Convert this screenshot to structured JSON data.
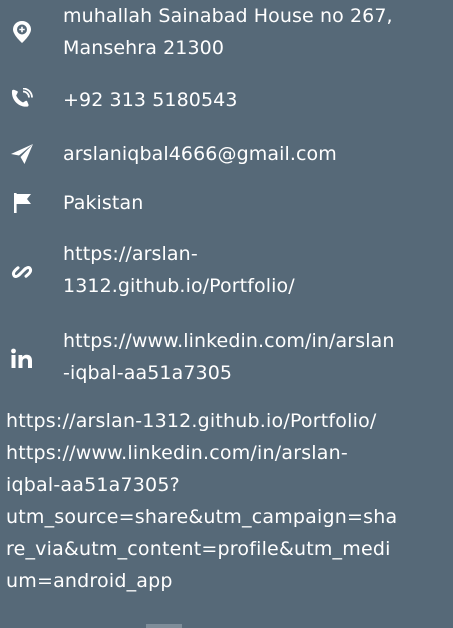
{
  "contact": {
    "address_line1": "muhallah Sainabad House no 267,",
    "address_line2": "Mansehra 21300",
    "phone": "+92 313 5180543",
    "email": "arslaniqbal4666@gmail.com",
    "country": "Pakistan",
    "portfolio_line1": "https://arslan-",
    "portfolio_line2": "1312.github.io/Portfolio/",
    "linkedin_line1": "https://www.linkedin.com/in/arslan",
    "linkedin_line2": "-iqbal-aa51a7305"
  },
  "notes": {
    "line1": "https://arslan-1312.github.io/Portfolio/",
    "line2": "https://www.linkedin.com/in/arslan-",
    "line3": "iqbal-aa51a7305?",
    "line4": "utm_source=share&utm_campaign=sha",
    "line5": "re_via&utm_content=profile&utm_medi",
    "line6": "um=android_app"
  },
  "icons": {
    "address": "location-pin-icon",
    "phone": "phone-icon",
    "email": "paper-plane-icon",
    "country": "flag-icon",
    "portfolio": "link-icon",
    "linkedin": "linkedin-icon"
  },
  "colors": {
    "background": "#566978",
    "text": "#ffffff"
  }
}
